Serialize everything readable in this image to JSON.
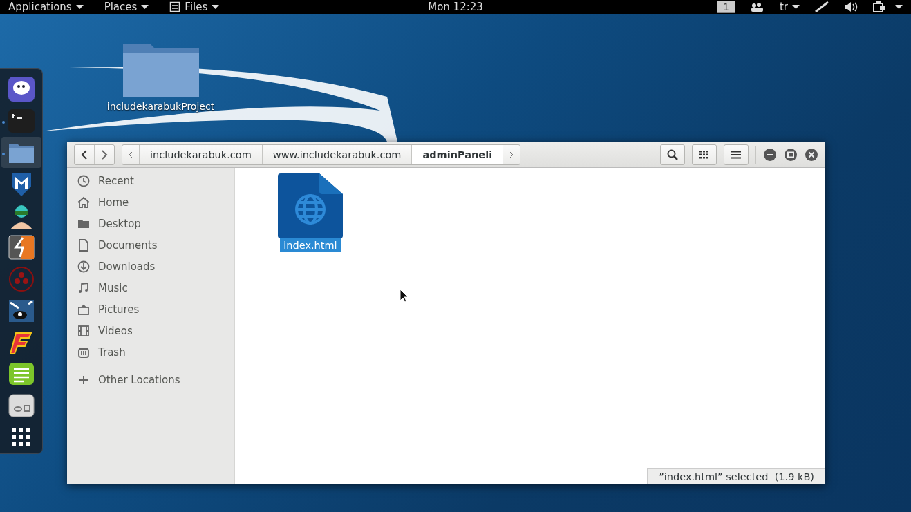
{
  "top_bar": {
    "menus": [
      {
        "label": "Applications",
        "kind": "menu"
      },
      {
        "label": "Places",
        "kind": "menu"
      },
      {
        "label": "Files",
        "kind": "app"
      }
    ],
    "clock": "Mon 12:23",
    "workspace": "1",
    "tray": [
      {
        "kind": "people"
      },
      {
        "kind": "keyboard",
        "label": "tr"
      },
      {
        "kind": "network"
      },
      {
        "kind": "volume"
      },
      {
        "kind": "power"
      }
    ]
  },
  "desktop_icons": [
    {
      "label": "includekarabukProject"
    }
  ],
  "dock": {
    "items": [
      {
        "kind": "penguin",
        "running": false,
        "selected": false
      },
      {
        "kind": "terminal",
        "running": true,
        "selected": false
      },
      {
        "kind": "folder",
        "running": true,
        "selected": true
      },
      {
        "kind": "shield",
        "running": false,
        "selected": false
      },
      {
        "kind": "avatar",
        "running": false,
        "selected": false
      },
      {
        "kind": "bolt",
        "running": false,
        "selected": false
      },
      {
        "kind": "dots",
        "running": false,
        "selected": false
      },
      {
        "kind": "beast",
        "running": false,
        "selected": false
      },
      {
        "kind": "letter",
        "running": false,
        "selected": false
      },
      {
        "kind": "notes",
        "running": false,
        "selected": false
      },
      {
        "kind": "tweaks",
        "running": false,
        "selected": false
      },
      {
        "kind": "grid",
        "running": false,
        "selected": false
      }
    ]
  },
  "window": {
    "path": [
      {
        "label": "includekarabuk.com",
        "selected": false
      },
      {
        "label": "www.includekarabuk.com",
        "selected": false
      },
      {
        "label": "adminPaneli",
        "selected": true
      }
    ],
    "sidebar": {
      "items": [
        {
          "label": "Recent",
          "kind": "recent"
        },
        {
          "label": "Home",
          "kind": "home"
        },
        {
          "label": "Desktop",
          "kind": "desktop"
        },
        {
          "label": "Documents",
          "kind": "documents"
        },
        {
          "label": "Downloads",
          "kind": "downloads"
        },
        {
          "label": "Music",
          "kind": "music"
        },
        {
          "label": "Pictures",
          "kind": "pictures"
        },
        {
          "label": "Videos",
          "kind": "videos"
        },
        {
          "label": "Trash",
          "kind": "trash"
        }
      ],
      "other": {
        "label": "Other Locations"
      }
    },
    "files": [
      {
        "name": "index.html",
        "selected": true
      }
    ],
    "status": "”index.html” selected  (1.9 kB)"
  }
}
